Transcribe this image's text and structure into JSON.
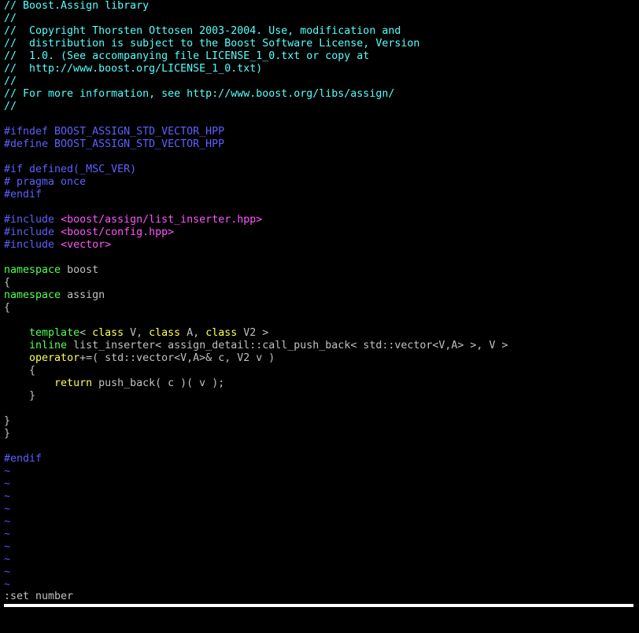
{
  "colors": {
    "comment": "#55ffff",
    "preproc": "#5f5fff",
    "include_path": "#ff55ff",
    "keyword": "#55ff55",
    "type": "#ffff55",
    "text": "#c0c0c0",
    "tilde": "#5555ff",
    "statusbar": "#ffffff"
  },
  "buffer": {
    "lines": [
      [
        {
          "text": "// Boost.Assign library",
          "t": "comment"
        }
      ],
      [
        {
          "text": "//",
          "t": "comment"
        }
      ],
      [
        {
          "text": "//  Copyright Thorsten Ottosen 2003-2004. Use, modification and",
          "t": "comment"
        }
      ],
      [
        {
          "text": "//  distribution is subject to the Boost Software License, Version",
          "t": "comment"
        }
      ],
      [
        {
          "text": "//  1.0. (See accompanying file LICENSE_1_0.txt or copy at",
          "t": "comment"
        }
      ],
      [
        {
          "text": "//  http://www.boost.org/LICENSE_1_0.txt)",
          "t": "comment"
        }
      ],
      [
        {
          "text": "//",
          "t": "comment"
        }
      ],
      [
        {
          "text": "// For more information, see http://www.boost.org/libs/assign/",
          "t": "comment"
        }
      ],
      [
        {
          "text": "//",
          "t": "comment"
        }
      ],
      [],
      [
        {
          "text": "#ifndef BOOST_ASSIGN_STD_VECTOR_HPP",
          "t": "preproc"
        }
      ],
      [
        {
          "text": "#define BOOST_ASSIGN_STD_VECTOR_HPP",
          "t": "preproc"
        }
      ],
      [],
      [
        {
          "text": "#if defined(_MSC_VER)",
          "t": "preproc"
        }
      ],
      [
        {
          "text": "# pragma once",
          "t": "preproc"
        }
      ],
      [
        {
          "text": "#endif",
          "t": "preproc"
        }
      ],
      [],
      [
        {
          "text": "#include ",
          "t": "preproc"
        },
        {
          "text": "<boost/assign/list_inserter.hpp>",
          "t": "include_path"
        }
      ],
      [
        {
          "text": "#include ",
          "t": "preproc"
        },
        {
          "text": "<boost/config.hpp>",
          "t": "include_path"
        }
      ],
      [
        {
          "text": "#include ",
          "t": "preproc"
        },
        {
          "text": "<vector>",
          "t": "include_path"
        }
      ],
      [],
      [
        {
          "text": "namespace",
          "t": "keyword"
        },
        {
          "text": " boost",
          "t": "text"
        }
      ],
      [
        {
          "text": "{",
          "t": "text"
        }
      ],
      [
        {
          "text": "namespace",
          "t": "keyword"
        },
        {
          "text": " assign",
          "t": "text"
        }
      ],
      [
        {
          "text": "{",
          "t": "text"
        }
      ],
      [],
      [
        {
          "text": "    ",
          "t": "text"
        },
        {
          "text": "template",
          "t": "keyword"
        },
        {
          "text": "< ",
          "t": "text"
        },
        {
          "text": "class",
          "t": "type"
        },
        {
          "text": " V, ",
          "t": "text"
        },
        {
          "text": "class",
          "t": "type"
        },
        {
          "text": " A, ",
          "t": "text"
        },
        {
          "text": "class",
          "t": "type"
        },
        {
          "text": " V2 >",
          "t": "text"
        }
      ],
      [
        {
          "text": "    ",
          "t": "text"
        },
        {
          "text": "inline",
          "t": "keyword"
        },
        {
          "text": " list_inserter< assign_detail::call_push_back< std::vector<V,A> >, V >",
          "t": "text"
        }
      ],
      [
        {
          "text": "    ",
          "t": "text"
        },
        {
          "text": "operator",
          "t": "type"
        },
        {
          "text": "+=( std::vector<V,A>& c, V2 v )",
          "t": "text"
        }
      ],
      [
        {
          "text": "    {",
          "t": "text"
        }
      ],
      [
        {
          "text": "        ",
          "t": "text"
        },
        {
          "text": "return",
          "t": "type"
        },
        {
          "text": " push_back( c )( v );",
          "t": "text"
        }
      ],
      [
        {
          "text": "    }",
          "t": "text"
        }
      ],
      [],
      [
        {
          "text": "}",
          "t": "text"
        }
      ],
      [
        {
          "text": "}",
          "t": "text"
        }
      ],
      [],
      [
        {
          "text": "#endif",
          "t": "preproc"
        }
      ]
    ],
    "tilde_char": "~",
    "tilde_count": 10
  },
  "command_line": ":set number"
}
